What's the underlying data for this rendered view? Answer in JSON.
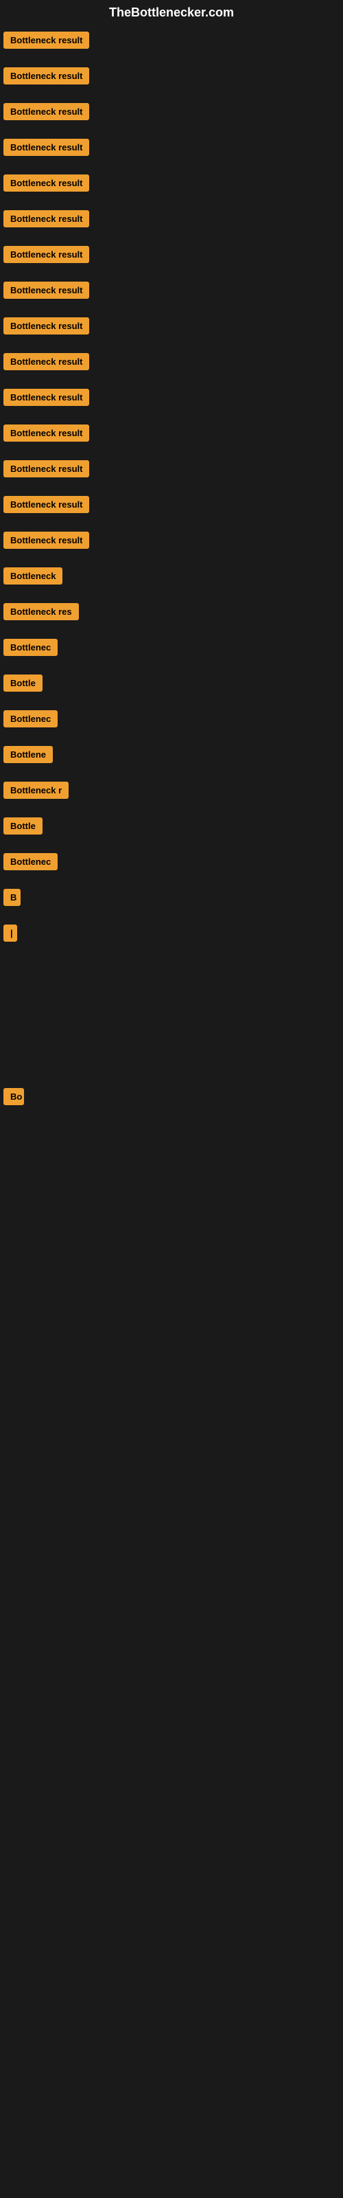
{
  "site": {
    "title": "TheBottlenecker.com"
  },
  "items": [
    {
      "id": 1,
      "label": "Bottleneck result",
      "width": 180
    },
    {
      "id": 2,
      "label": "Bottleneck result",
      "width": 180
    },
    {
      "id": 3,
      "label": "Bottleneck result",
      "width": 180
    },
    {
      "id": 4,
      "label": "Bottleneck result",
      "width": 180
    },
    {
      "id": 5,
      "label": "Bottleneck result",
      "width": 180
    },
    {
      "id": 6,
      "label": "Bottleneck result",
      "width": 180
    },
    {
      "id": 7,
      "label": "Bottleneck result",
      "width": 180
    },
    {
      "id": 8,
      "label": "Bottleneck result",
      "width": 180
    },
    {
      "id": 9,
      "label": "Bottleneck result",
      "width": 180
    },
    {
      "id": 10,
      "label": "Bottleneck result",
      "width": 180
    },
    {
      "id": 11,
      "label": "Bottleneck result",
      "width": 180
    },
    {
      "id": 12,
      "label": "Bottleneck result",
      "width": 180
    },
    {
      "id": 13,
      "label": "Bottleneck result",
      "width": 180
    },
    {
      "id": 14,
      "label": "Bottleneck result",
      "width": 180
    },
    {
      "id": 15,
      "label": "Bottleneck result",
      "width": 165
    },
    {
      "id": 16,
      "label": "Bottleneck",
      "width": 100
    },
    {
      "id": 17,
      "label": "Bottleneck res",
      "width": 120
    },
    {
      "id": 18,
      "label": "Bottlenec",
      "width": 90
    },
    {
      "id": 19,
      "label": "Bottle",
      "width": 70
    },
    {
      "id": 20,
      "label": "Bottlenec",
      "width": 90
    },
    {
      "id": 21,
      "label": "Bottlene",
      "width": 80
    },
    {
      "id": 22,
      "label": "Bottleneck r",
      "width": 105
    },
    {
      "id": 23,
      "label": "Bottle",
      "width": 65
    },
    {
      "id": 24,
      "label": "Bottlenec",
      "width": 88
    },
    {
      "id": 25,
      "label": "B",
      "width": 25
    },
    {
      "id": 26,
      "label": "|",
      "width": 15
    },
    {
      "id": 27,
      "label": "",
      "width": 0,
      "spacer": true
    },
    {
      "id": 28,
      "label": "",
      "width": 0,
      "spacer": true
    },
    {
      "id": 29,
      "label": "",
      "width": 0,
      "spacer": true
    },
    {
      "id": 30,
      "label": "Bo",
      "width": 30
    }
  ]
}
